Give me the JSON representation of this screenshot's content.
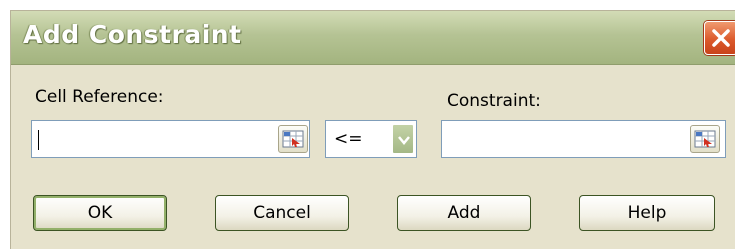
{
  "dialog": {
    "title": "Add Constraint",
    "close_icon": "close-icon"
  },
  "cell_reference": {
    "label": "Cell Reference:",
    "value": "",
    "ref_icon": "range-select-icon"
  },
  "operator": {
    "selected": "<=",
    "dropdown_icon": "chevron-down-icon"
  },
  "constraint": {
    "label": "Constraint:",
    "value": "",
    "ref_icon": "range-select-icon"
  },
  "buttons": {
    "ok": "OK",
    "cancel": "Cancel",
    "add": "Add",
    "help": "Help"
  },
  "colors": {
    "titlebar": "#b5c394",
    "body": "#e6e2cc",
    "close": "#dc5a2c"
  }
}
